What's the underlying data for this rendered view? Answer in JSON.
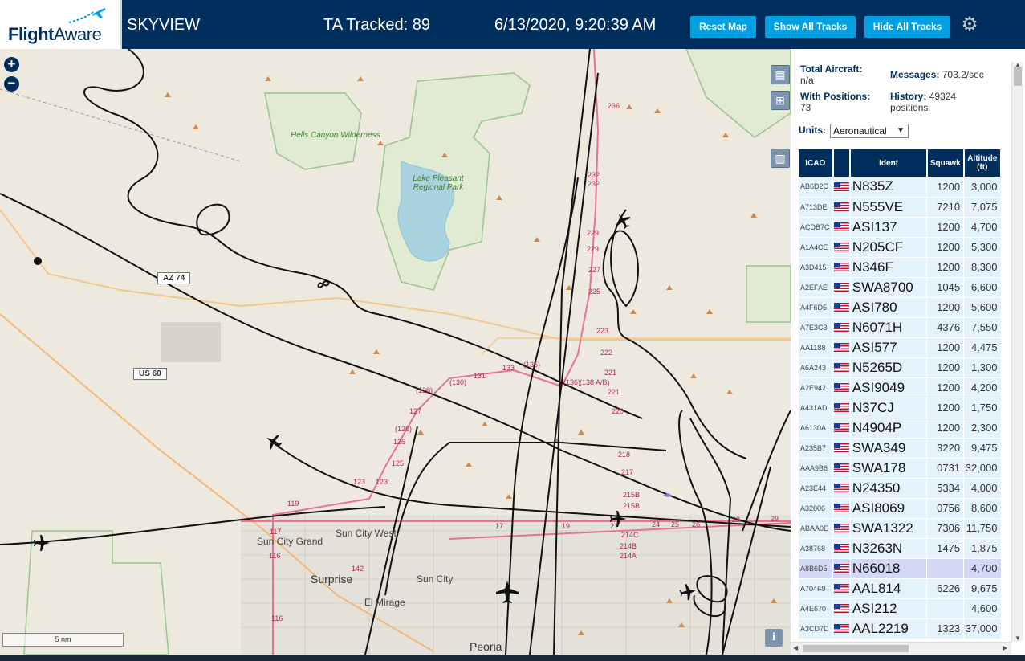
{
  "header": {
    "logo_text_a": "Flight",
    "logo_text_b": "Aware",
    "title": "SKYVIEW",
    "tracked": "TA Tracked: 89",
    "datetime": "6/13/2020, 9:20:39 AM",
    "buttons": {
      "reset": "Reset Map",
      "show_all": "Show All Tracks",
      "hide_all": "Hide All Tracks"
    },
    "settings_icon": "gear-icon"
  },
  "map": {
    "zoom_in": "+",
    "zoom_out": "−",
    "scale": "5 nm",
    "info": "i",
    "labels": {
      "hells_canyon": "Hells Canyon Wilderness",
      "lake_pleasant": "Lake Pleasant Regional Park",
      "az74": "AZ 74",
      "us60": "US 60",
      "sun_city_west": "Sun City West",
      "sun_city_grand": "Sun City Grand",
      "surprise": "Surprise",
      "sun_city": "Sun City",
      "el_mirage": "El Mirage",
      "peoria": "Peoria"
    },
    "road_numbers": [
      "236",
      "232",
      "232",
      "229",
      "229",
      "227",
      "225",
      "223",
      "222",
      "221",
      "221",
      "220",
      "218",
      "217",
      "215B",
      "215B",
      "214C",
      "214B",
      "214A",
      "119",
      "116",
      "117",
      "116",
      "(128)",
      "127",
      "(130)",
      "131",
      "133",
      "(135)",
      "(136)",
      "(138 A/B)",
      "(126)",
      "126",
      "125",
      "123",
      "123",
      "142",
      "17",
      "19",
      "21",
      "24",
      "25",
      "26",
      "28",
      "29"
    ]
  },
  "panel": {
    "stats": {
      "total_label": "Total Aircraft:",
      "total_value": "n/a",
      "messages_label": "Messages:",
      "messages_value": "703.2/sec",
      "positions_label": "With Positions:",
      "positions_value": "73",
      "history_label": "History:",
      "history_value": "49324 positions"
    },
    "units_label": "Units:",
    "units_value": "Aeronautical",
    "columns": [
      "ICAO",
      "",
      "Ident",
      "Squawk",
      "Altitude (ft)"
    ],
    "rows": [
      {
        "icao": "AB6D2C",
        "ident": "N835Z",
        "squawk": "1200",
        "alt": "3,000"
      },
      {
        "icao": "A713DE",
        "ident": "N555VE",
        "squawk": "7210",
        "alt": "7,075"
      },
      {
        "icao": "ACDB7C",
        "ident": "ASI137",
        "squawk": "1200",
        "alt": "4,700"
      },
      {
        "icao": "A1A4CE",
        "ident": "N205CF",
        "squawk": "1200",
        "alt": "5,300"
      },
      {
        "icao": "A3D415",
        "ident": "N346F",
        "squawk": "1200",
        "alt": "8,300"
      },
      {
        "icao": "A2EFAE",
        "ident": "SWA8700",
        "squawk": "1045",
        "alt": "6,600"
      },
      {
        "icao": "A4F6D5",
        "ident": "ASI780",
        "squawk": "1200",
        "alt": "5,600"
      },
      {
        "icao": "A7E3C3",
        "ident": "N6071H",
        "squawk": "4376",
        "alt": "7,550"
      },
      {
        "icao": "AA1188",
        "ident": "ASI577",
        "squawk": "1200",
        "alt": "4,475"
      },
      {
        "icao": "A6A243",
        "ident": "N5265D",
        "squawk": "1200",
        "alt": "1,300"
      },
      {
        "icao": "A2E942",
        "ident": "ASI9049",
        "squawk": "1200",
        "alt": "4,200"
      },
      {
        "icao": "A431AD",
        "ident": "N37CJ",
        "squawk": "1200",
        "alt": "1,750"
      },
      {
        "icao": "A6130A",
        "ident": "N4904P",
        "squawk": "1200",
        "alt": "2,300"
      },
      {
        "icao": "A235B7",
        "ident": "SWA349",
        "squawk": "3220",
        "alt": "9,475"
      },
      {
        "icao": "AAA9B6",
        "ident": "SWA178",
        "squawk": "0731",
        "alt": "32,000"
      },
      {
        "icao": "A23E44",
        "ident": "N24350",
        "squawk": "5334",
        "alt": "4,000"
      },
      {
        "icao": "A32806",
        "ident": "ASI8069",
        "squawk": "0756",
        "alt": "8,600"
      },
      {
        "icao": "ABAA0E",
        "ident": "SWA1322",
        "squawk": "7306",
        "alt": "11,750"
      },
      {
        "icao": "A38768",
        "ident": "N3263N",
        "squawk": "1475",
        "alt": "1,875"
      },
      {
        "icao": "A8B6D5",
        "ident": "N66018",
        "squawk": "",
        "alt": "4,700",
        "selected": true
      },
      {
        "icao": "A704F9",
        "ident": "AAL814",
        "squawk": "6226",
        "alt": "9,675"
      },
      {
        "icao": "A4E670",
        "ident": "ASI212",
        "squawk": "",
        "alt": "4,600"
      },
      {
        "icao": "A3CD7D",
        "ident": "AAL2219",
        "squawk": "1323",
        "alt": "37,000"
      }
    ]
  },
  "colors": {
    "header_bg": "#002f5d",
    "button": "#00a0e2",
    "row_bg": "#e4f3fb",
    "row_selected": "#d2d8f5"
  }
}
